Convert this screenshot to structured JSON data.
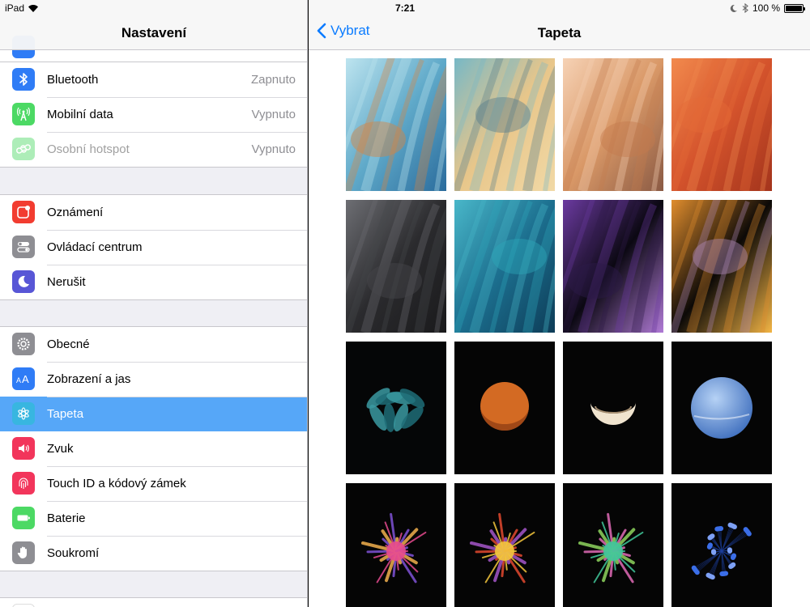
{
  "status_bar": {
    "device": "iPad",
    "time": "7:21",
    "battery": "100 %",
    "battery_level": 1.0
  },
  "sidebar": {
    "title": "Nastavení",
    "groups": [
      {
        "items": [
          {
            "label": "Bluetooth",
            "value": "Zapnuto",
            "icon": "bluetooth-icon",
            "color": "#2f7cf6"
          },
          {
            "label": "Mobilní data",
            "value": "Vypnuto",
            "icon": "antenna-icon",
            "color": "#4cd964"
          },
          {
            "label": "Osobní hotspot",
            "value": "Vypnuto",
            "icon": "hotspot-icon",
            "color": "#4cd964"
          }
        ]
      },
      {
        "items": [
          {
            "label": "Oznámení",
            "icon": "notifications-icon",
            "color": "#f23c30"
          },
          {
            "label": "Ovládací centrum",
            "icon": "control-center-icon",
            "color": "#8e8e93"
          },
          {
            "label": "Nerušit",
            "icon": "moon-icon",
            "color": "#5856d6"
          }
        ]
      },
      {
        "items": [
          {
            "label": "Obecné",
            "icon": "gear-icon",
            "color": "#8e8e93"
          },
          {
            "label": "Zobrazení a jas",
            "icon": "display-icon",
            "color": "#2f7cf6"
          },
          {
            "label": "Tapeta",
            "icon": "wallpaper-icon",
            "color": "#38b6e0",
            "selected": true
          },
          {
            "label": "Zvuk",
            "icon": "speaker-icon",
            "color": "#f2355b"
          },
          {
            "label": "Touch ID a kódový zámek",
            "icon": "fingerprint-icon",
            "color": "#f2355b"
          },
          {
            "label": "Baterie",
            "icon": "battery-icon",
            "color": "#4cd964"
          },
          {
            "label": "Soukromí",
            "icon": "hand-icon",
            "color": "#8e8e93"
          }
        ]
      },
      {
        "items": [
          {
            "label": "iCloud",
            "icon": "icloud-icon",
            "color": "#ffffff"
          }
        ]
      }
    ]
  },
  "detail": {
    "back_label": "Vybrat",
    "title": "Tapeta",
    "wallpapers": [
      {
        "name": "wallpaper-blue-abstract",
        "colors": [
          "#5fa9c9",
          "#bde4ef",
          "#2a6b9c",
          "#d9833e"
        ]
      },
      {
        "name": "wallpaper-sand-dunes",
        "colors": [
          "#e8c68a",
          "#77b8c6",
          "#f1d9a6",
          "#567d8c"
        ]
      },
      {
        "name": "wallpaper-desert-ripples",
        "colors": [
          "#d99867",
          "#f6d2b5",
          "#8a5a44",
          "#c47a4e"
        ]
      },
      {
        "name": "wallpaper-red-feathers",
        "colors": [
          "#d4532c",
          "#f28a4d",
          "#a3341c",
          "#e46b37"
        ]
      },
      {
        "name": "wallpaper-gray-feathers",
        "colors": [
          "#2b2b2e",
          "#6d6e73",
          "#1a1a1c",
          "#46474b"
        ]
      },
      {
        "name": "wallpaper-teal-feathers",
        "colors": [
          "#1c6f8f",
          "#49b7c9",
          "#0d3c57",
          "#2da6b9"
        ]
      },
      {
        "name": "wallpaper-purple-flower",
        "colors": [
          "#0b0812",
          "#6b3aa0",
          "#b07ad6",
          "#2d1a49"
        ]
      },
      {
        "name": "wallpaper-orange-flower",
        "colors": [
          "#0c0907",
          "#e08d2d",
          "#f3b545",
          "#b08ab6"
        ]
      },
      {
        "name": "wallpaper-teal-leaves",
        "colors": [
          "#050607",
          "#1f6d77",
          "#3b9aa1",
          "#20423f"
        ]
      },
      {
        "name": "wallpaper-mars",
        "colors": [
          "#050505",
          "#d36a23",
          "#8a3a12",
          "#e48c3b"
        ]
      },
      {
        "name": "wallpaper-moon",
        "colors": [
          "#050505",
          "#d5c4ad",
          "#a68f72",
          "#f0e4cf"
        ]
      },
      {
        "name": "wallpaper-neptune",
        "colors": [
          "#050505",
          "#6a9ae0",
          "#b6d2f5",
          "#3f6fbe"
        ]
      },
      {
        "name": "wallpaper-pink-powder",
        "colors": [
          "#050505",
          "#e54a8e",
          "#7f52d6",
          "#f2b04d"
        ]
      },
      {
        "name": "wallpaper-yellow-powder",
        "colors": [
          "#050505",
          "#f3c53c",
          "#e2492f",
          "#a455c9"
        ]
      },
      {
        "name": "wallpaper-green-powder",
        "colors": [
          "#050505",
          "#40c79a",
          "#e06ab6",
          "#8ed45e"
        ]
      },
      {
        "name": "wallpaper-blue-dots",
        "colors": [
          "#050505",
          "#3b6ee8",
          "#7ea1f5",
          "#1c3f9e"
        ]
      }
    ]
  }
}
